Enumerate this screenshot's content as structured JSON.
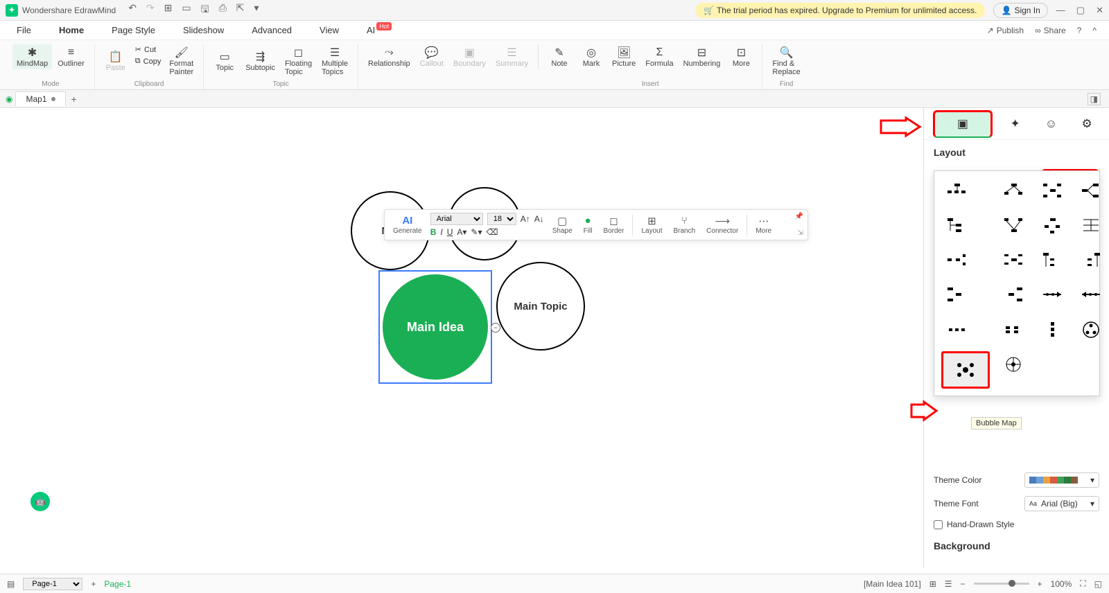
{
  "app": {
    "name": "Wondershare EdrawMind"
  },
  "trial": {
    "text": "The trial period has expired. Upgrade to Premium for unlimited access."
  },
  "signin": "Sign In",
  "menu": {
    "file": "File",
    "home": "Home",
    "page_style": "Page Style",
    "slideshow": "Slideshow",
    "advanced": "Advanced",
    "view": "View",
    "ai": "AI",
    "hot": "Hot",
    "publish": "Publish",
    "share": "Share"
  },
  "ribbon": {
    "mindmap": "MindMap",
    "outliner": "Outliner",
    "mode": "Mode",
    "paste": "Paste",
    "cut": "Cut",
    "copy": "Copy",
    "format_painter": "Format\nPainter",
    "clipboard": "Clipboard",
    "topic": "Topic",
    "subtopic": "Subtopic",
    "floating_topic": "Floating\nTopic",
    "multiple_topics": "Multiple\nTopics",
    "topic_group": "Topic",
    "relationship": "Relationship",
    "callout": "Callout",
    "boundary": "Boundary",
    "summary": "Summary",
    "note": "Note",
    "mark": "Mark",
    "picture": "Picture",
    "formula": "Formula",
    "numbering": "Numbering",
    "more": "More",
    "insert": "Insert",
    "find_replace": "Find &\nReplace",
    "find": "Find"
  },
  "tabs": {
    "doc": "Map1"
  },
  "canvas": {
    "main_idea": "Main Idea",
    "main_topic": "Main Topic",
    "mai": "Mai"
  },
  "float": {
    "generate": "Generate",
    "font": "Arial",
    "size": "18",
    "shape": "Shape",
    "fill": "Fill",
    "border": "Border",
    "layout": "Layout",
    "branch": "Branch",
    "connector": "Connector",
    "more": "More"
  },
  "side": {
    "layout_title": "Layout",
    "layout_label": "Layout",
    "theme_color": "Theme Color",
    "theme_font": "Theme Font",
    "theme_font_val": "Arial (Big)",
    "hand_drawn": "Hand-Drawn Style",
    "background": "Background",
    "tooltip": "Bubble Map"
  },
  "status": {
    "page": "Page-1",
    "page_tab": "Page-1",
    "info": "[Main Idea 101]",
    "zoom": "100%"
  },
  "colors": {
    "accent": "#1aaf54",
    "red": "#ff0000"
  }
}
